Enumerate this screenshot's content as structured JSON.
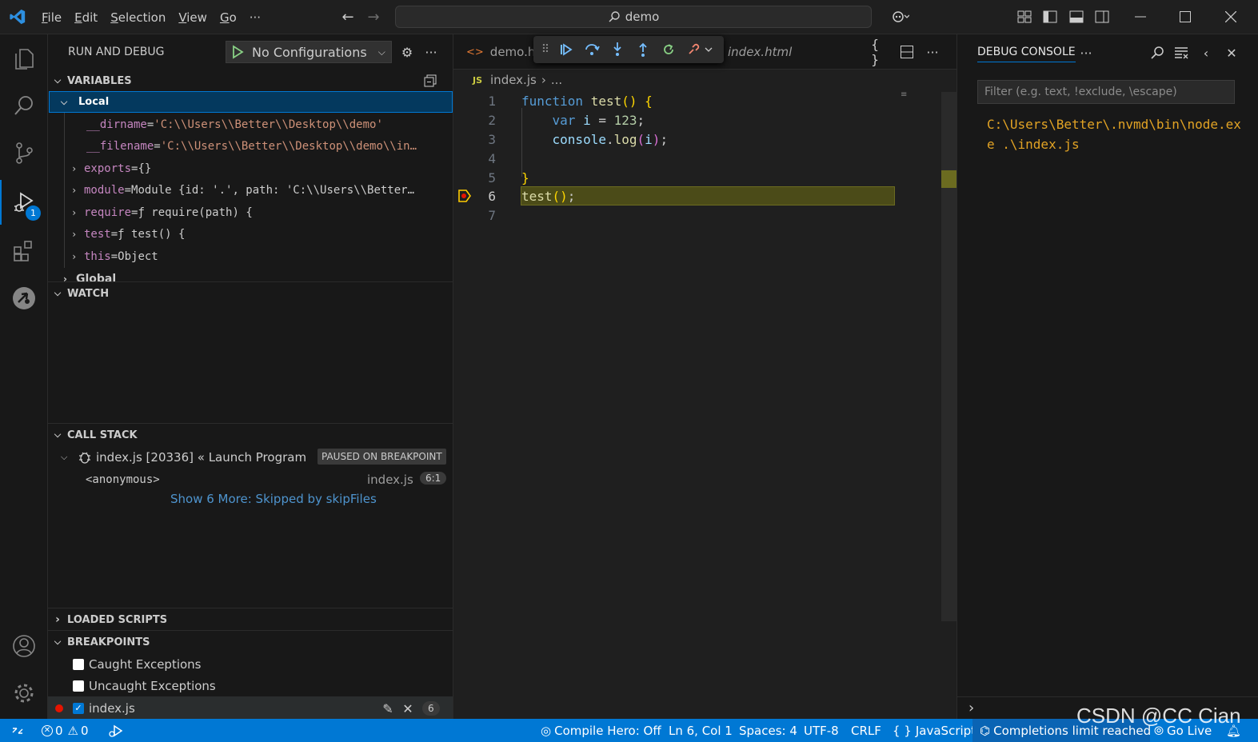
{
  "menu": [
    "File",
    "Edit",
    "Selection",
    "View",
    "Go",
    "···"
  ],
  "command_center": "demo",
  "sidebar": {
    "title": "RUN AND DEBUG",
    "config_label": "No Configurations",
    "variables_header": "VARIABLES",
    "local_label": "Local",
    "variables": [
      {
        "name": "__dirname",
        "eq": " = ",
        "value": "'C:\\\\Users\\\\Better\\\\Desktop\\\\demo'"
      },
      {
        "name": "__filename",
        "eq": " = ",
        "value": "'C:\\\\Users\\\\Better\\\\Desktop\\\\demo\\\\in…"
      },
      {
        "name": "exports",
        "eq": " = ",
        "value": "{}"
      },
      {
        "name": "module",
        "eq": " = ",
        "value": "Module {id: '.', path: 'C:\\\\Users\\\\Better…"
      },
      {
        "name": "require",
        "eq": " = ",
        "value": "ƒ require(path) {"
      },
      {
        "name": "test",
        "eq": " = ",
        "value": "ƒ test() {"
      },
      {
        "name": "this",
        "eq": " = ",
        "value": "Object"
      }
    ],
    "global_label": "Global",
    "watch_header": "WATCH",
    "callstack_header": "CALL STACK",
    "callstack_session": "index.js [20336] « Launch Program",
    "paused_badge": "PAUSED ON BREAKPOINT",
    "frame_name": "<anonymous>",
    "frame_file": "index.js",
    "frame_pos": "6:1",
    "show_more": "Show 6 More: Skipped by skipFiles",
    "loaded_scripts_header": "LOADED SCRIPTS",
    "breakpoints_header": "BREAKPOINTS",
    "bp_caught": "Caught Exceptions",
    "bp_uncaught": "Uncaught Exceptions",
    "bp_file": "index.js",
    "bp_count": "6"
  },
  "editor": {
    "tab1": "demo.ht",
    "tab2": "index.html",
    "breadcrumb_file": "index.js",
    "breadcrumb_more": "...",
    "breadcrumb_lang": "JS",
    "line_numbers": [
      "1",
      "2",
      "3",
      "4",
      "5",
      "6",
      "7"
    ]
  },
  "panel": {
    "title": "DEBUG CONSOLE",
    "filter_placeholder": "Filter (e.g. text, !exclude, \\escape)",
    "output": "C:\\Users\\Better\\.nvmd\\bin\\node.exe .\\index.js"
  },
  "statusbar": {
    "errors": "0",
    "warnings": "0",
    "compile_hero": "Compile Hero: Off",
    "position": "Ln 6, Col 1",
    "spaces": "Spaces: 4",
    "encoding": "UTF-8",
    "eol": "CRLF",
    "language": "JavaScript",
    "completions": "Completions limit reached",
    "golive": "Go Live"
  },
  "watermark": "CSDN @CC Cian",
  "colors": {
    "accent": "#0078d4",
    "statusbar": "#0078d4",
    "breakpoint": "#e51400",
    "console_text": "#e2a324"
  }
}
